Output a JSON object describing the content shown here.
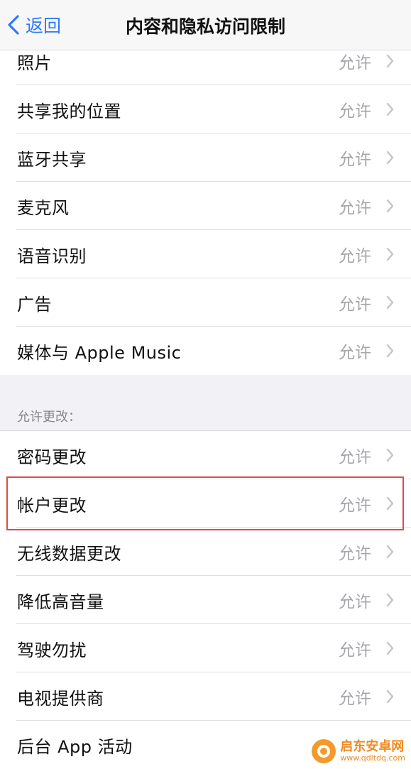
{
  "nav": {
    "back_label": "返回",
    "title": "内容和隐私访问限制"
  },
  "group1": [
    {
      "label": "照片",
      "value": "允许"
    },
    {
      "label": "共享我的位置",
      "value": "允许"
    },
    {
      "label": "蓝牙共享",
      "value": "允许"
    },
    {
      "label": "麦克风",
      "value": "允许"
    },
    {
      "label": "语音识别",
      "value": "允许"
    },
    {
      "label": "广告",
      "value": "允许"
    },
    {
      "label": "媒体与 Apple Music",
      "value": "允许"
    }
  ],
  "section_header": "允许更改：",
  "group2": [
    {
      "label": "密码更改",
      "value": "允许"
    },
    {
      "label": "帐户更改",
      "value": "允许"
    },
    {
      "label": "无线数据更改",
      "value": "允许"
    },
    {
      "label": "降低高音量",
      "value": "允许"
    },
    {
      "label": "驾驶勿扰",
      "value": "允许"
    },
    {
      "label": "电视提供商",
      "value": "允许"
    },
    {
      "label": "后台 App 活动",
      "value": ""
    }
  ],
  "watermark": {
    "name": "启东安卓网",
    "url": "www.qdltdq.com"
  },
  "colors": {
    "accent": "#2f7bf6",
    "highlight": "#e04a4a",
    "secondary_text": "#a6a6ab"
  }
}
